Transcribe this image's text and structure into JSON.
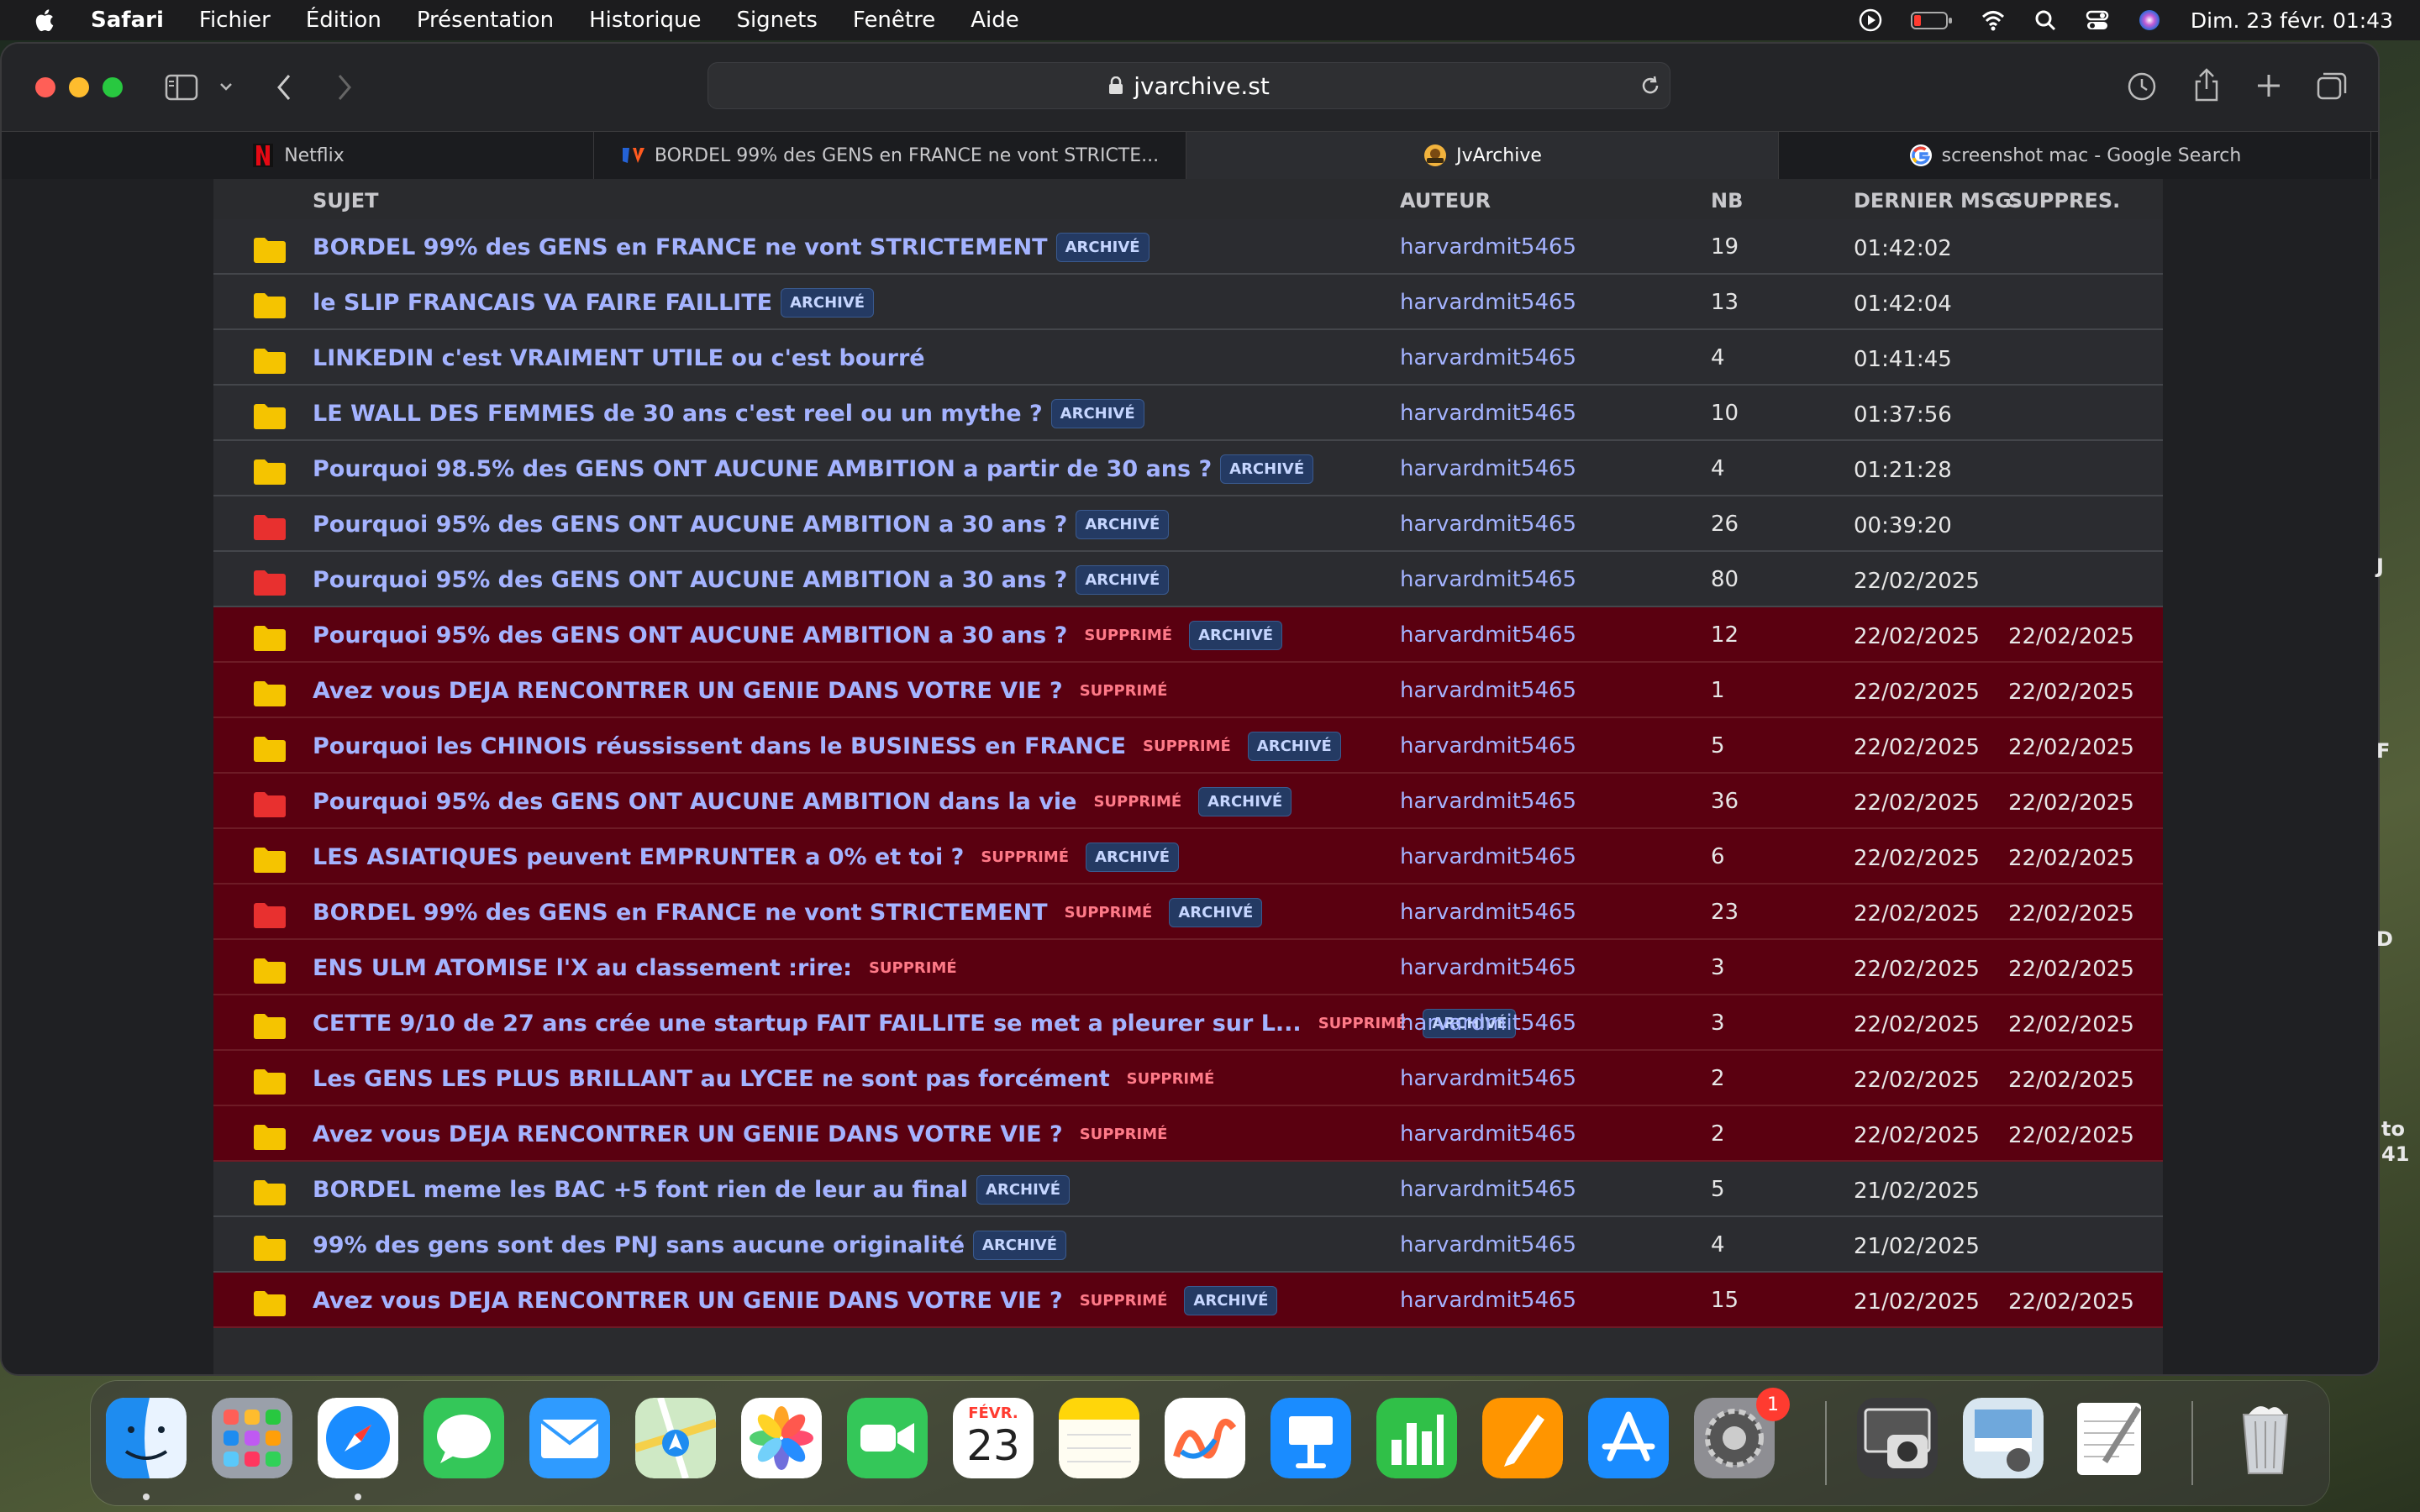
{
  "menubar": {
    "app_name": "Safari",
    "items": [
      "Fichier",
      "Édition",
      "Présentation",
      "Historique",
      "Signets",
      "Fenêtre",
      "Aide"
    ],
    "clock": "Dim. 23 févr.  01:43"
  },
  "browser": {
    "url": "jvarchive.st",
    "tabs": [
      {
        "label": "Netflix",
        "favicon": "netflix-icon"
      },
      {
        "label": "BORDEL 99% des GENS en FRANCE ne vont STRICTE...",
        "favicon": "jv-icon"
      },
      {
        "label": "JvArchive",
        "favicon": "jvarchive-icon"
      },
      {
        "label": "screenshot mac - Google Search",
        "favicon": "google-icon"
      }
    ],
    "active_tab": 2
  },
  "table": {
    "headers": {
      "subject": "SUJET",
      "author": "AUTEUR",
      "nb": "NB",
      "last": "DERNIER MSG.",
      "deleted": "SUPPRES."
    },
    "badges": {
      "archived": "ARCHIVÉ",
      "deleted": "SUPPRIMÉ"
    },
    "rows": [
      {
        "title": "BORDEL 99% des GENS en FRANCE ne vont STRICTEMENT",
        "archived": true,
        "deleted": false,
        "folder": "yellow",
        "author": "harvardmit5465",
        "nb": "19",
        "last": "01:42:02",
        "deleted_at": ""
      },
      {
        "title": "le SLIP FRANCAIS VA FAIRE FAILLITE",
        "archived": true,
        "deleted": false,
        "folder": "yellow",
        "author": "harvardmit5465",
        "nb": "13",
        "last": "01:42:04",
        "deleted_at": ""
      },
      {
        "title": "LINKEDIN c'est VRAIMENT UTILE ou c'est bourré",
        "archived": false,
        "deleted": false,
        "folder": "yellow",
        "author": "harvardmit5465",
        "nb": "4",
        "last": "01:41:45",
        "deleted_at": ""
      },
      {
        "title": "LE WALL DES FEMMES de 30 ans c'est reel ou un mythe ?",
        "archived": true,
        "deleted": false,
        "folder": "yellow",
        "author": "harvardmit5465",
        "nb": "10",
        "last": "01:37:56",
        "deleted_at": ""
      },
      {
        "title": "Pourquoi 98.5% des GENS ONT AUCUNE AMBITION a partir de 30 ans ?",
        "archived": true,
        "deleted": false,
        "folder": "yellow",
        "author": "harvardmit5465",
        "nb": "4",
        "last": "01:21:28",
        "deleted_at": ""
      },
      {
        "title": "Pourquoi 95% des GENS ONT AUCUNE AMBITION a 30 ans ?",
        "archived": true,
        "deleted": false,
        "folder": "red",
        "author": "harvardmit5465",
        "nb": "26",
        "last": "00:39:20",
        "deleted_at": ""
      },
      {
        "title": "Pourquoi 95% des GENS ONT AUCUNE AMBITION a 30 ans ?",
        "archived": true,
        "deleted": false,
        "folder": "red",
        "author": "harvardmit5465",
        "nb": "80",
        "last": "22/02/2025",
        "deleted_at": ""
      },
      {
        "title": "Pourquoi 95% des GENS ONT AUCUNE AMBITION a 30 ans ?",
        "archived": true,
        "deleted": true,
        "folder": "yellow",
        "author": "harvardmit5465",
        "nb": "12",
        "last": "22/02/2025",
        "deleted_at": "22/02/2025"
      },
      {
        "title": "Avez vous DEJA RENCONTRER UN GENIE DANS VOTRE VIE ?",
        "archived": false,
        "deleted": true,
        "folder": "yellow",
        "author": "harvardmit5465",
        "nb": "1",
        "last": "22/02/2025",
        "deleted_at": "22/02/2025"
      },
      {
        "title": "Pourquoi les CHINOIS réussissent dans le BUSINESS en FRANCE",
        "archived": true,
        "deleted": true,
        "folder": "yellow",
        "author": "harvardmit5465",
        "nb": "5",
        "last": "22/02/2025",
        "deleted_at": "22/02/2025"
      },
      {
        "title": "Pourquoi 95% des GENS ONT AUCUNE AMBITION dans la vie",
        "archived": true,
        "deleted": true,
        "folder": "red",
        "author": "harvardmit5465",
        "nb": "36",
        "last": "22/02/2025",
        "deleted_at": "22/02/2025"
      },
      {
        "title": "LES ASIATIQUES peuvent EMPRUNTER a 0% et toi ?",
        "archived": true,
        "deleted": true,
        "folder": "yellow",
        "author": "harvardmit5465",
        "nb": "6",
        "last": "22/02/2025",
        "deleted_at": "22/02/2025"
      },
      {
        "title": "BORDEL 99% des GENS en FRANCE ne vont STRICTEMENT",
        "archived": true,
        "deleted": true,
        "folder": "red",
        "author": "harvardmit5465",
        "nb": "23",
        "last": "22/02/2025",
        "deleted_at": "22/02/2025"
      },
      {
        "title": "ENS ULM ATOMISE l'X au classement :rire:",
        "archived": false,
        "deleted": true,
        "folder": "yellow",
        "author": "harvardmit5465",
        "nb": "3",
        "last": "22/02/2025",
        "deleted_at": "22/02/2025"
      },
      {
        "title": "CETTE 9/10 de 27 ans crée une startup FAIT FAILLITE se met a pleurer sur L...",
        "archived": true,
        "deleted": true,
        "folder": "yellow",
        "author": "harvardmit5465",
        "nb": "3",
        "last": "22/02/2025",
        "deleted_at": "22/02/2025"
      },
      {
        "title": "Les GENS LES PLUS BRILLANT au LYCEE ne sont pas forcément",
        "archived": false,
        "deleted": true,
        "folder": "yellow",
        "author": "harvardmit5465",
        "nb": "2",
        "last": "22/02/2025",
        "deleted_at": "22/02/2025"
      },
      {
        "title": "Avez vous DEJA RENCONTRER UN GENIE DANS VOTRE VIE ?",
        "archived": false,
        "deleted": true,
        "folder": "yellow",
        "author": "harvardmit5465",
        "nb": "2",
        "last": "22/02/2025",
        "deleted_at": "22/02/2025"
      },
      {
        "title": "BORDEL meme les BAC +5 font rien de leur au final",
        "archived": true,
        "deleted": false,
        "folder": "yellow",
        "author": "harvardmit5465",
        "nb": "5",
        "last": "21/02/2025",
        "deleted_at": ""
      },
      {
        "title": "99% des gens sont des PNJ sans aucune originalité",
        "archived": true,
        "deleted": false,
        "folder": "yellow",
        "author": "harvardmit5465",
        "nb": "4",
        "last": "21/02/2025",
        "deleted_at": ""
      },
      {
        "title": "Avez vous DEJA RENCONTRER UN GENIE DANS VOTRE VIE ?",
        "archived": true,
        "deleted": true,
        "folder": "yellow",
        "author": "harvardmit5465",
        "nb": "15",
        "last": "21/02/2025",
        "deleted_at": "22/02/2025"
      }
    ]
  },
  "colors": {
    "folder_yellow": "#f5c400",
    "folder_red": "#e8302f",
    "deleted_row_bg": "#5a0010",
    "link": "#a4b3ff"
  },
  "desktop_peek": [
    "J",
    "F",
    "D",
    "to",
    "41"
  ],
  "dock": {
    "apps": [
      "Finder",
      "Launchpad",
      "Safari",
      "Messages",
      "Mail",
      "Plans",
      "Photos",
      "FaceTime",
      "Calendrier",
      "Notes",
      "Freeform",
      "Keynote",
      "Numbers",
      "Pages",
      "App Store",
      "Réglages Système",
      "Capture d'écran",
      "Aperçu",
      "TextEdit",
      "Corbeille"
    ],
    "calendar_month": "FÉVR.",
    "calendar_day": "23",
    "settings_badge": "1"
  }
}
